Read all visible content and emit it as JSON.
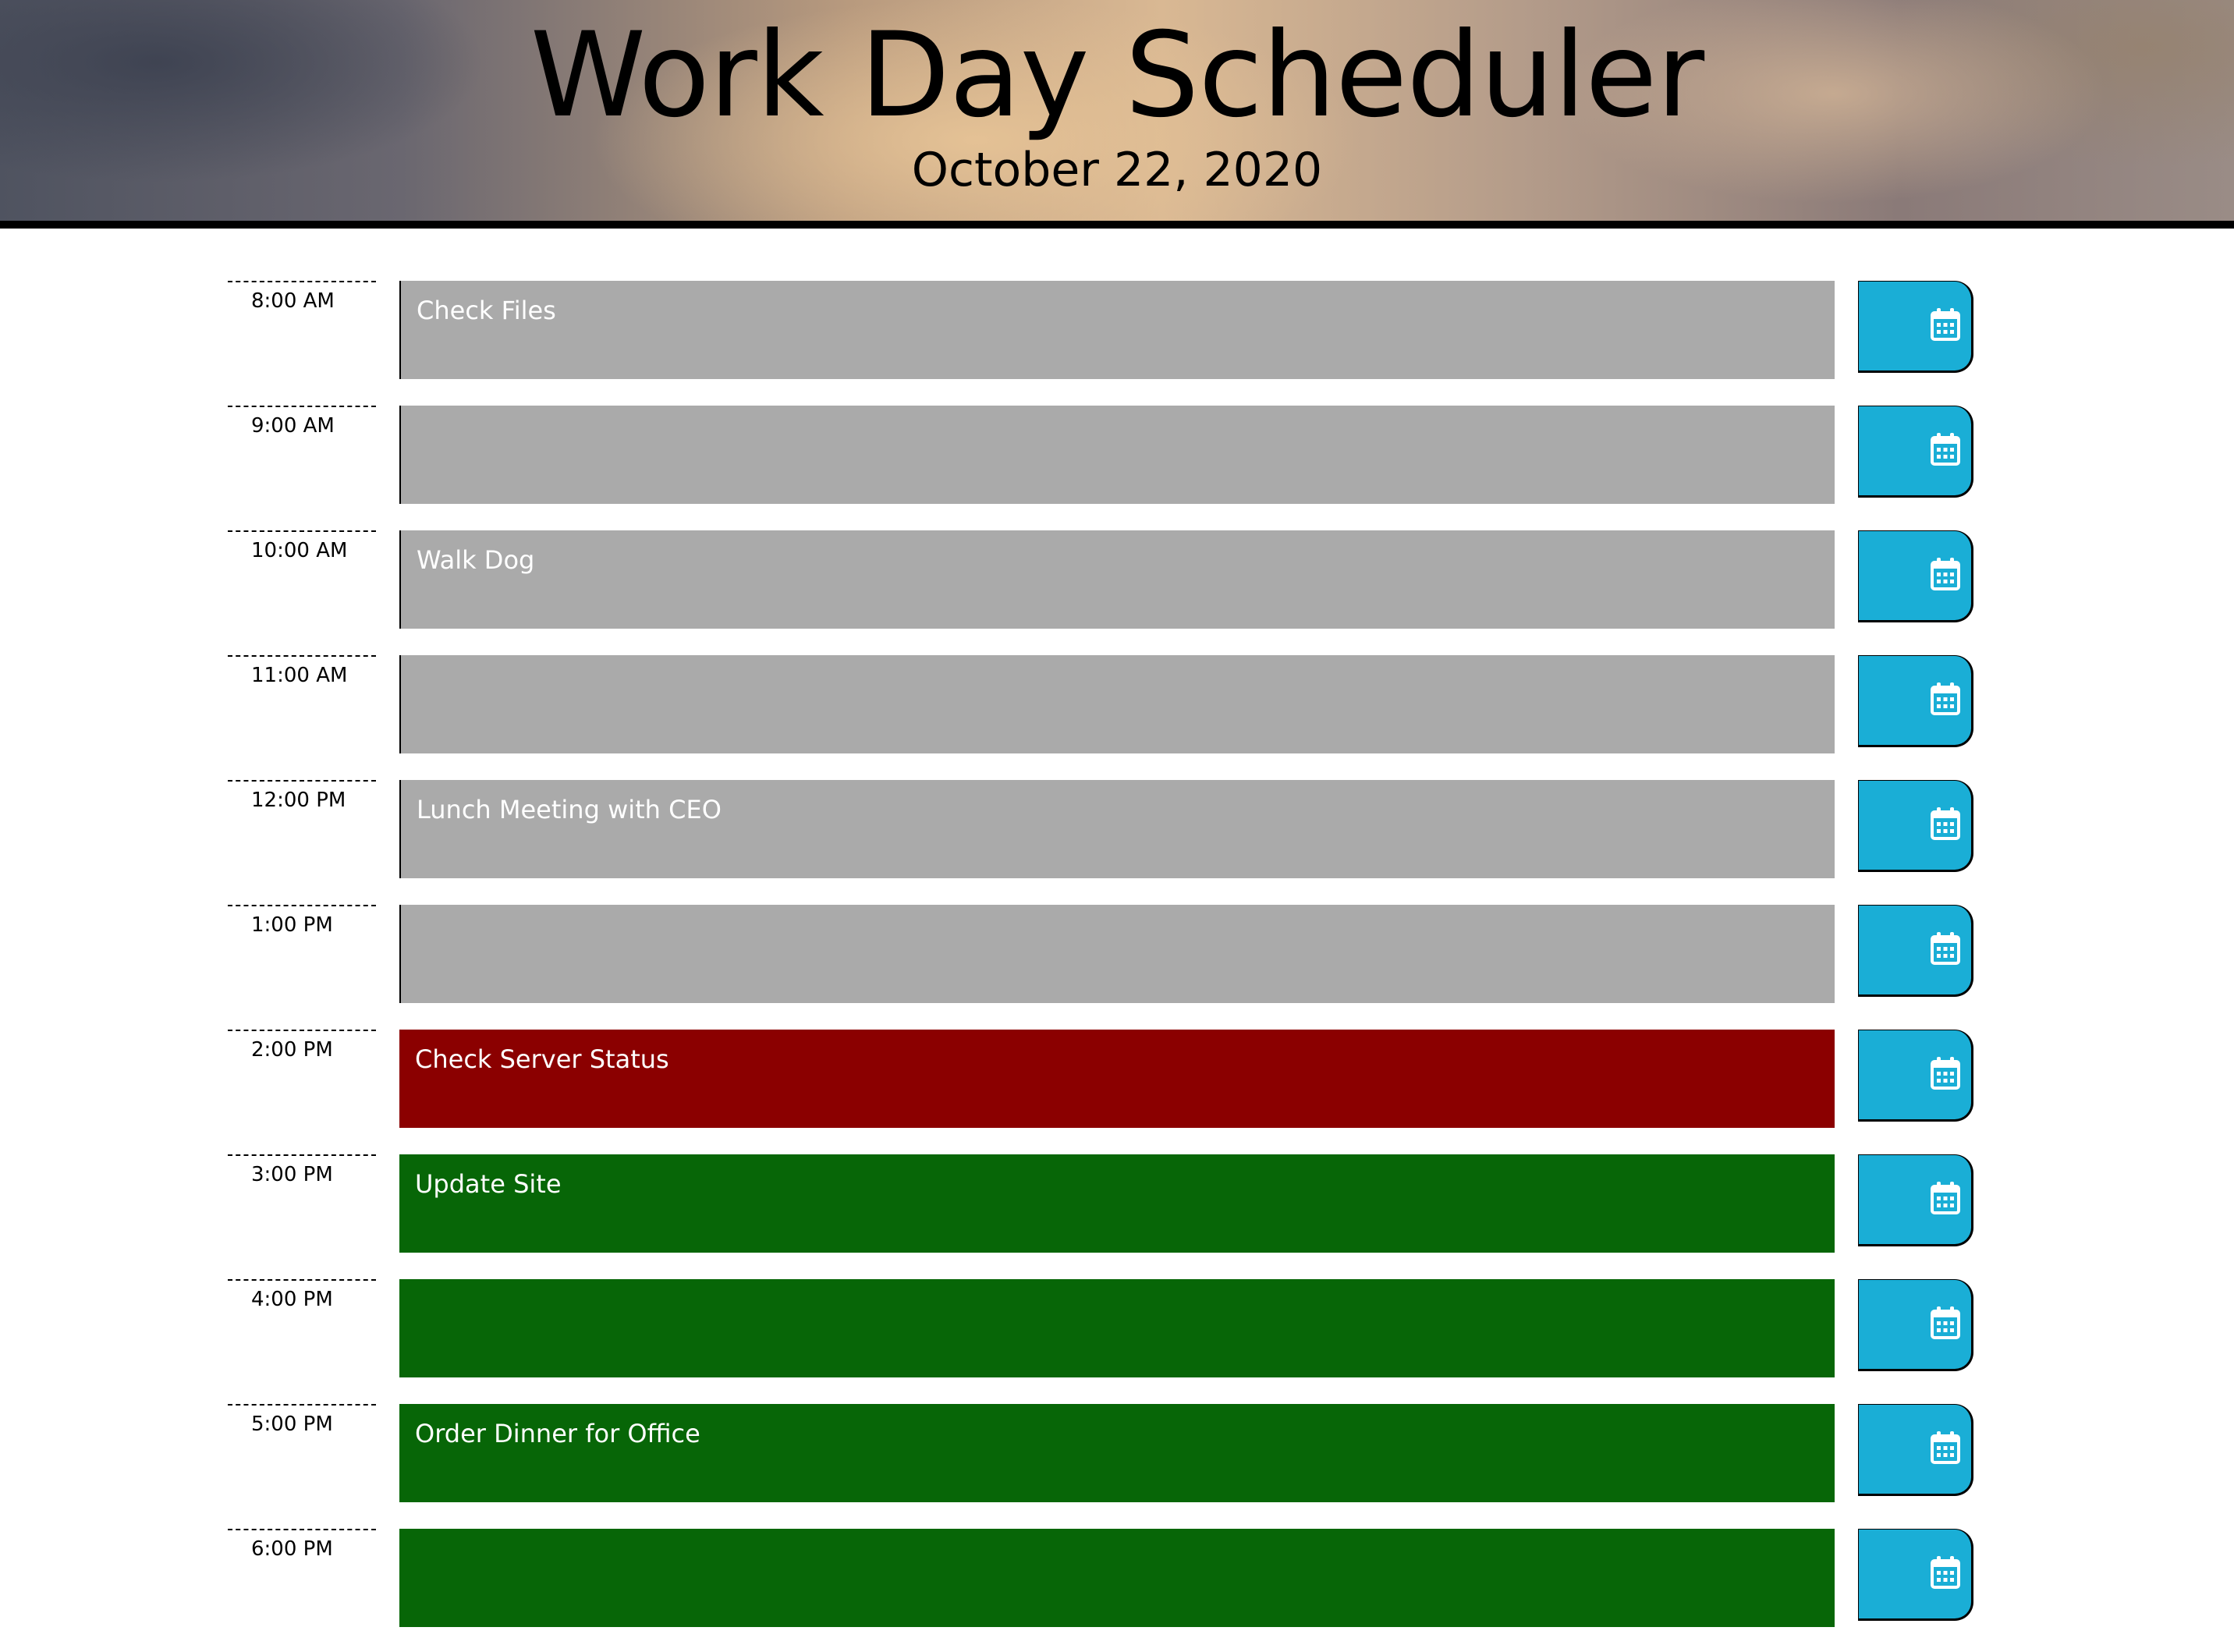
{
  "header": {
    "title": "Work Day Scheduler",
    "date": "October 22, 2020"
  },
  "colors": {
    "past": "#aaaaaa",
    "present": "#8b0000",
    "future": "#076607",
    "save_button": "#1aaed6"
  },
  "save_icon": "calendar-icon",
  "rows": [
    {
      "hour": "8:00 AM",
      "text": "Check Files",
      "status": "past"
    },
    {
      "hour": "9:00 AM",
      "text": "",
      "status": "past"
    },
    {
      "hour": "10:00 AM",
      "text": "Walk Dog",
      "status": "past"
    },
    {
      "hour": "11:00 AM",
      "text": "",
      "status": "past"
    },
    {
      "hour": "12:00 PM",
      "text": "Lunch Meeting with CEO",
      "status": "past"
    },
    {
      "hour": "1:00 PM",
      "text": "",
      "status": "past"
    },
    {
      "hour": "2:00 PM",
      "text": "Check Server Status",
      "status": "present"
    },
    {
      "hour": "3:00 PM",
      "text": "Update Site",
      "status": "future"
    },
    {
      "hour": "4:00 PM",
      "text": "",
      "status": "future"
    },
    {
      "hour": "5:00 PM",
      "text": "Order Dinner for Office",
      "status": "future"
    },
    {
      "hour": "6:00 PM",
      "text": "",
      "status": "future"
    }
  ]
}
